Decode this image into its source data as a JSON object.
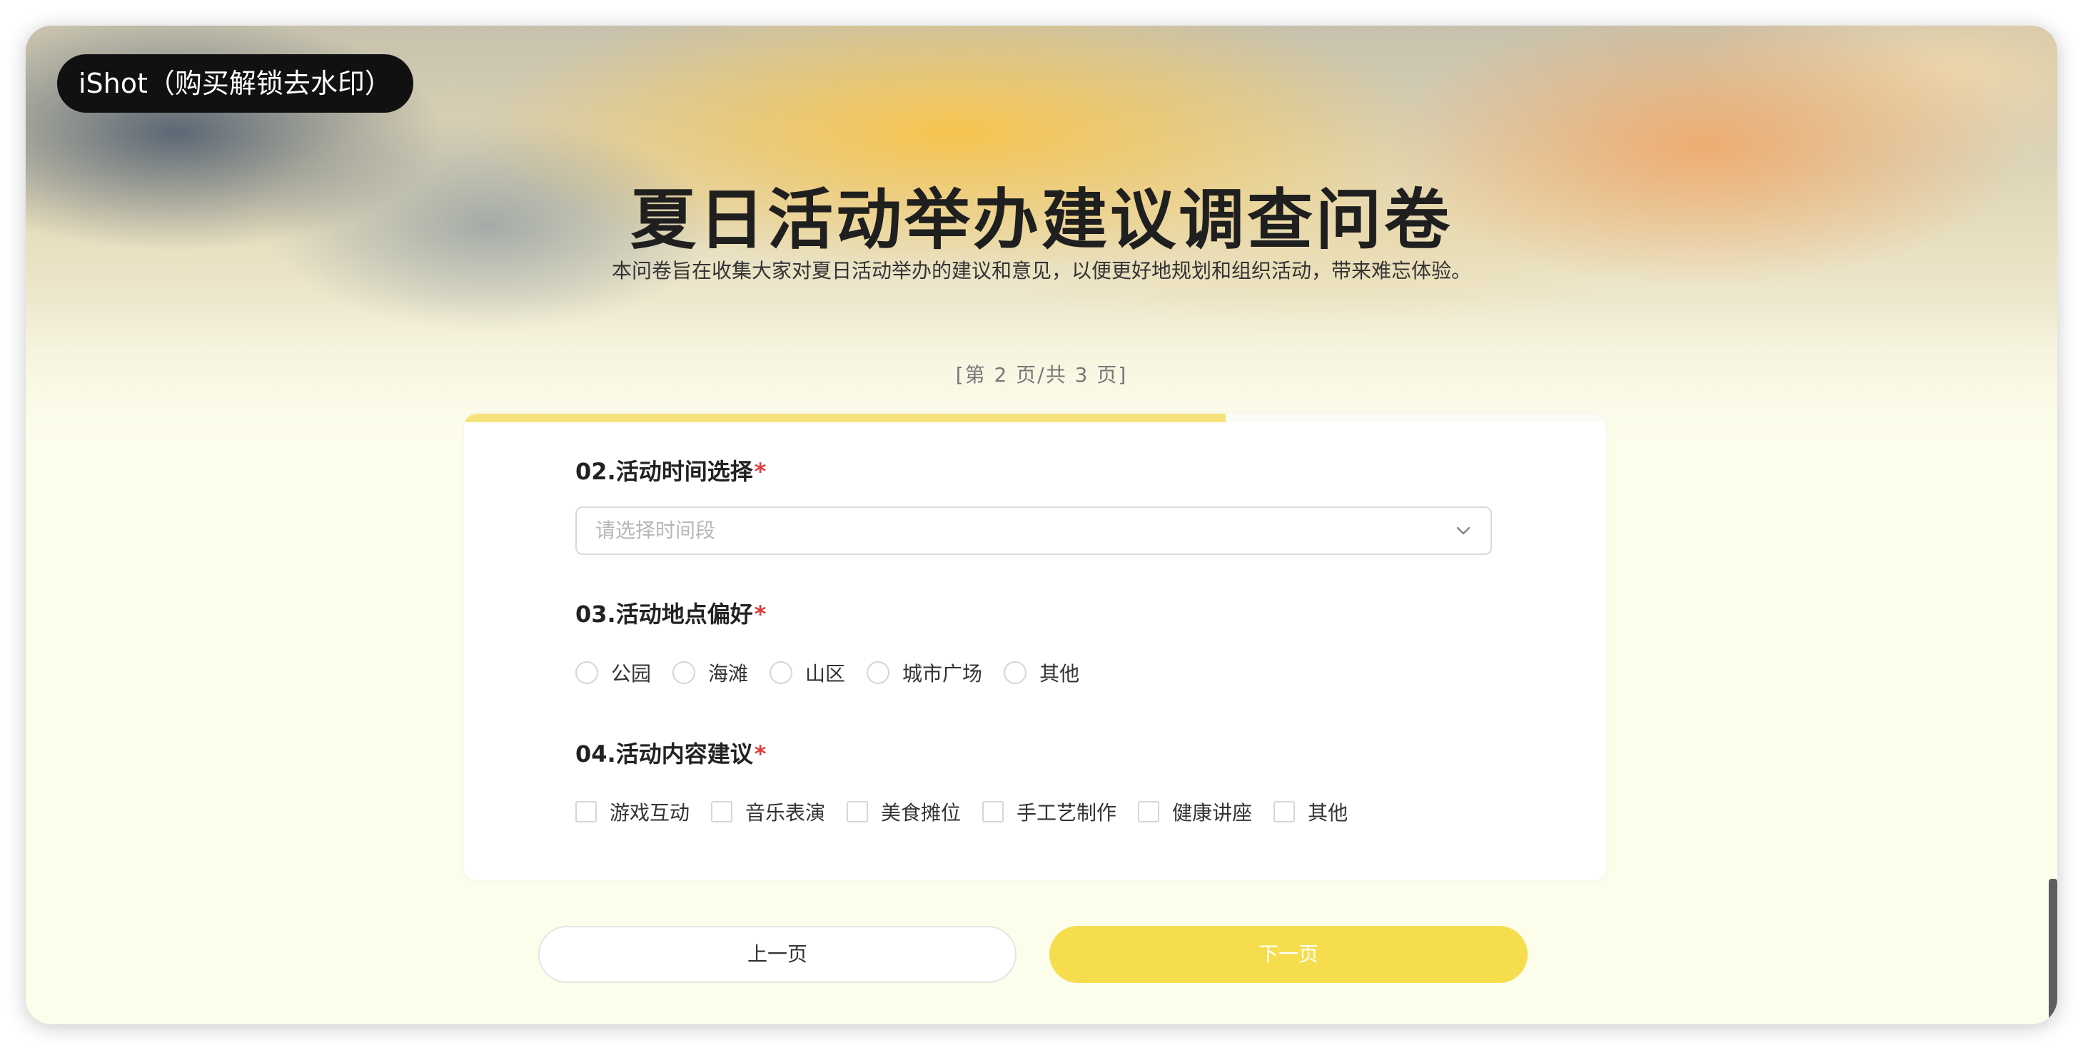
{
  "watermark": "iShot（购买解锁去水印）",
  "header": {
    "title": "夏日活动举办建议调查问卷",
    "subtitle": "本问卷旨在收集大家对夏日活动举办的建议和意见，以便更好地规划和组织活动，带来难忘体验。",
    "page_indicator": "[第 2 页/共 3 页]",
    "progress": 0.667
  },
  "questions": {
    "q2": {
      "label": "02.活动时间选择",
      "required_mark": "*",
      "placeholder": "请选择时间段",
      "icon": "chevron-down-icon"
    },
    "q3": {
      "label": "03.活动地点偏好",
      "required_mark": "*",
      "options": [
        "公园",
        "海滩",
        "山区",
        "城市广场",
        "其他"
      ]
    },
    "q4": {
      "label": "04.活动内容建议",
      "required_mark": "*",
      "options": [
        "游戏互动",
        "音乐表演",
        "美食摊位",
        "手工艺制作",
        "健康讲座",
        "其他"
      ]
    }
  },
  "buttons": {
    "prev": "上一页",
    "next": "下一页"
  },
  "colors": {
    "accent": "#f5dd4e",
    "progress": "#f6e27a",
    "required": "#e03b3b",
    "background": "#fdfdec"
  }
}
